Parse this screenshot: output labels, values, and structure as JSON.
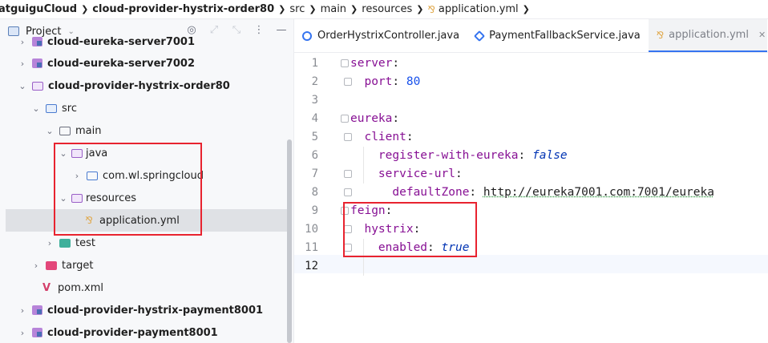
{
  "breadcrumb": {
    "items": [
      {
        "label": "atguiguCloud",
        "bold": true
      },
      {
        "label": "cloud-provider-hystrix-order80",
        "bold": true
      },
      {
        "label": "src",
        "bold": false
      },
      {
        "label": "main",
        "bold": false
      },
      {
        "label": "resources",
        "bold": false
      },
      {
        "label": "application.yml",
        "bold": false
      }
    ]
  },
  "project_panel": {
    "title": "Project",
    "tree": [
      {
        "label": "cloud-eureka-server7001",
        "bold": true,
        "icon": "module-icon",
        "chevron": "›"
      },
      {
        "label": "cloud-eureka-server7002",
        "bold": true,
        "icon": "module-icon",
        "chevron": "›"
      },
      {
        "label": "cloud-provider-hystrix-order80",
        "bold": true,
        "icon": "module-icon",
        "chevron": "⌄"
      },
      {
        "label": "src",
        "bold": false,
        "icon": "source-folder-icon",
        "chevron": "⌄"
      },
      {
        "label": "main",
        "bold": false,
        "icon": "folder-icon",
        "chevron": "⌄"
      },
      {
        "label": "java",
        "bold": false,
        "icon": "java-folder-icon",
        "chevron": "⌄"
      },
      {
        "label": "com.wl.springcloud",
        "bold": false,
        "icon": "package-icon",
        "chevron": "›"
      },
      {
        "label": "resources",
        "bold": false,
        "icon": "resources-folder-icon",
        "chevron": "⌄"
      },
      {
        "label": "application.yml",
        "bold": false,
        "icon": "yaml-file-icon",
        "chevron": ""
      },
      {
        "label": "test",
        "bold": false,
        "icon": "test-folder-icon",
        "chevron": "›"
      },
      {
        "label": "target",
        "bold": false,
        "icon": "target-folder-icon",
        "chevron": "›"
      },
      {
        "label": "pom.xml",
        "bold": false,
        "icon": "maven-file-icon",
        "chevron": ""
      },
      {
        "label": "cloud-provider-hystrix-payment8001",
        "bold": true,
        "icon": "module-icon",
        "chevron": "›"
      },
      {
        "label": "cloud-provider-payment8001",
        "bold": true,
        "icon": "module-icon",
        "chevron": "›"
      }
    ]
  },
  "editor": {
    "tabs": [
      {
        "label": "OrderHystrixController.java",
        "icon": "java-class-icon",
        "active": false
      },
      {
        "label": "PaymentFallbackService.java",
        "icon": "java-interface-icon",
        "active": false
      },
      {
        "label": "application.yml",
        "icon": "yaml-file-icon",
        "active": true
      }
    ],
    "line_numbers": [
      "1",
      "2",
      "3",
      "4",
      "5",
      "6",
      "7",
      "8",
      "9",
      "10",
      "11",
      "12"
    ],
    "code": {
      "l1_key": "server",
      "l2_key": "port",
      "l2_val": "80",
      "l4_key": "eureka",
      "l5_key": "client",
      "l6_key": "register-with-eureka",
      "l6_val": "false",
      "l7_key": "service-url",
      "l8_key": "defaultZone",
      "l8_val": "http://eureka7001.com:7001/eureka",
      "l9_key": "feign",
      "l10_key": "hystrix",
      "l11_key": "enabled",
      "l11_val": "true",
      "colon": ":"
    }
  },
  "colors": {
    "highlight_box": "#e8232f",
    "yaml_key": "#871094",
    "number": "#1750eb",
    "boolean": "#0033b3",
    "accent": "#3574f0"
  }
}
